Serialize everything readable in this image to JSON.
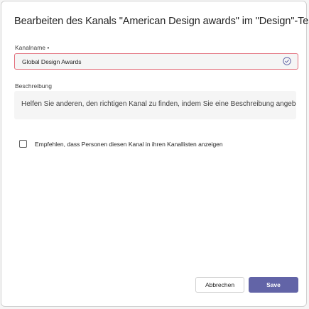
{
  "dialog": {
    "title": "Bearbeiten des Kanals \"American Design awards\" im \"Design\"-Team"
  },
  "channel_name": {
    "label": "Kanalname •",
    "value": "Global Design Awards",
    "status_icon": "check-circle-icon"
  },
  "description": {
    "label": "Beschreibung",
    "placeholder": "Helfen Sie anderen, den richtigen Kanal zu finden, indem Sie eine Beschreibung angeben."
  },
  "recommend": {
    "label": "Empfehlen, dass Personen diesen Kanal in ihren Kanallisten anzeigen",
    "checked": false
  },
  "actions": {
    "cancel_label": "Abbrechen",
    "save_label": "Save"
  },
  "colors": {
    "accent": "#6264a7",
    "error_border": "#e26d7a"
  }
}
